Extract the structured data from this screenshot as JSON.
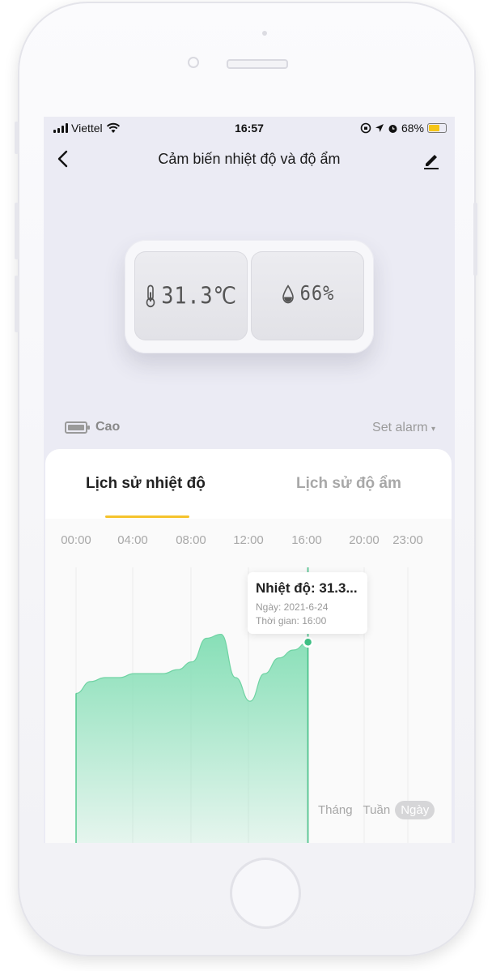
{
  "status_bar": {
    "carrier": "Viettel",
    "time": "16:57",
    "battery_percent": "68%",
    "battery_level": 0.68
  },
  "nav": {
    "title": "Cảm biến nhiệt độ và độ ẩm",
    "back_icon": "chevron-left-icon",
    "edit_icon": "pencil-icon"
  },
  "device": {
    "temperature": "31.3℃",
    "humidity": "66%"
  },
  "battery": {
    "label": "Cao"
  },
  "alarm": {
    "label": "Set alarm"
  },
  "tabs": [
    {
      "label": "Lịch sử nhiệt độ",
      "active": true
    },
    {
      "label": "Lịch sử độ ẩm",
      "active": false
    }
  ],
  "chart_data": {
    "type": "area",
    "x_labels": [
      "00:00",
      "04:00",
      "08:00",
      "12:00",
      "16:00",
      "20:00",
      "23:00"
    ],
    "x": [
      0,
      1,
      2,
      3,
      4,
      5,
      6,
      7,
      8,
      9,
      10,
      11,
      12,
      13,
      14,
      15,
      16
    ],
    "values": [
      29.8,
      30.1,
      30.2,
      30.2,
      30.3,
      30.3,
      30.3,
      30.4,
      30.6,
      31.2,
      31.3,
      30.2,
      29.6,
      30.3,
      30.7,
      30.9,
      31.1
    ],
    "xlim": [
      0,
      23
    ],
    "ylim": [
      26.0,
      33.0
    ],
    "color": "#87dfb7",
    "grid": true
  },
  "tooltip": {
    "title": "Nhiệt độ: 31.3...",
    "date": "Ngày: 2021-6-24",
    "time": "Thời gian: 16:00"
  },
  "range": {
    "month": "Tháng",
    "week": "Tuần",
    "day": "Ngày",
    "active": "day"
  }
}
